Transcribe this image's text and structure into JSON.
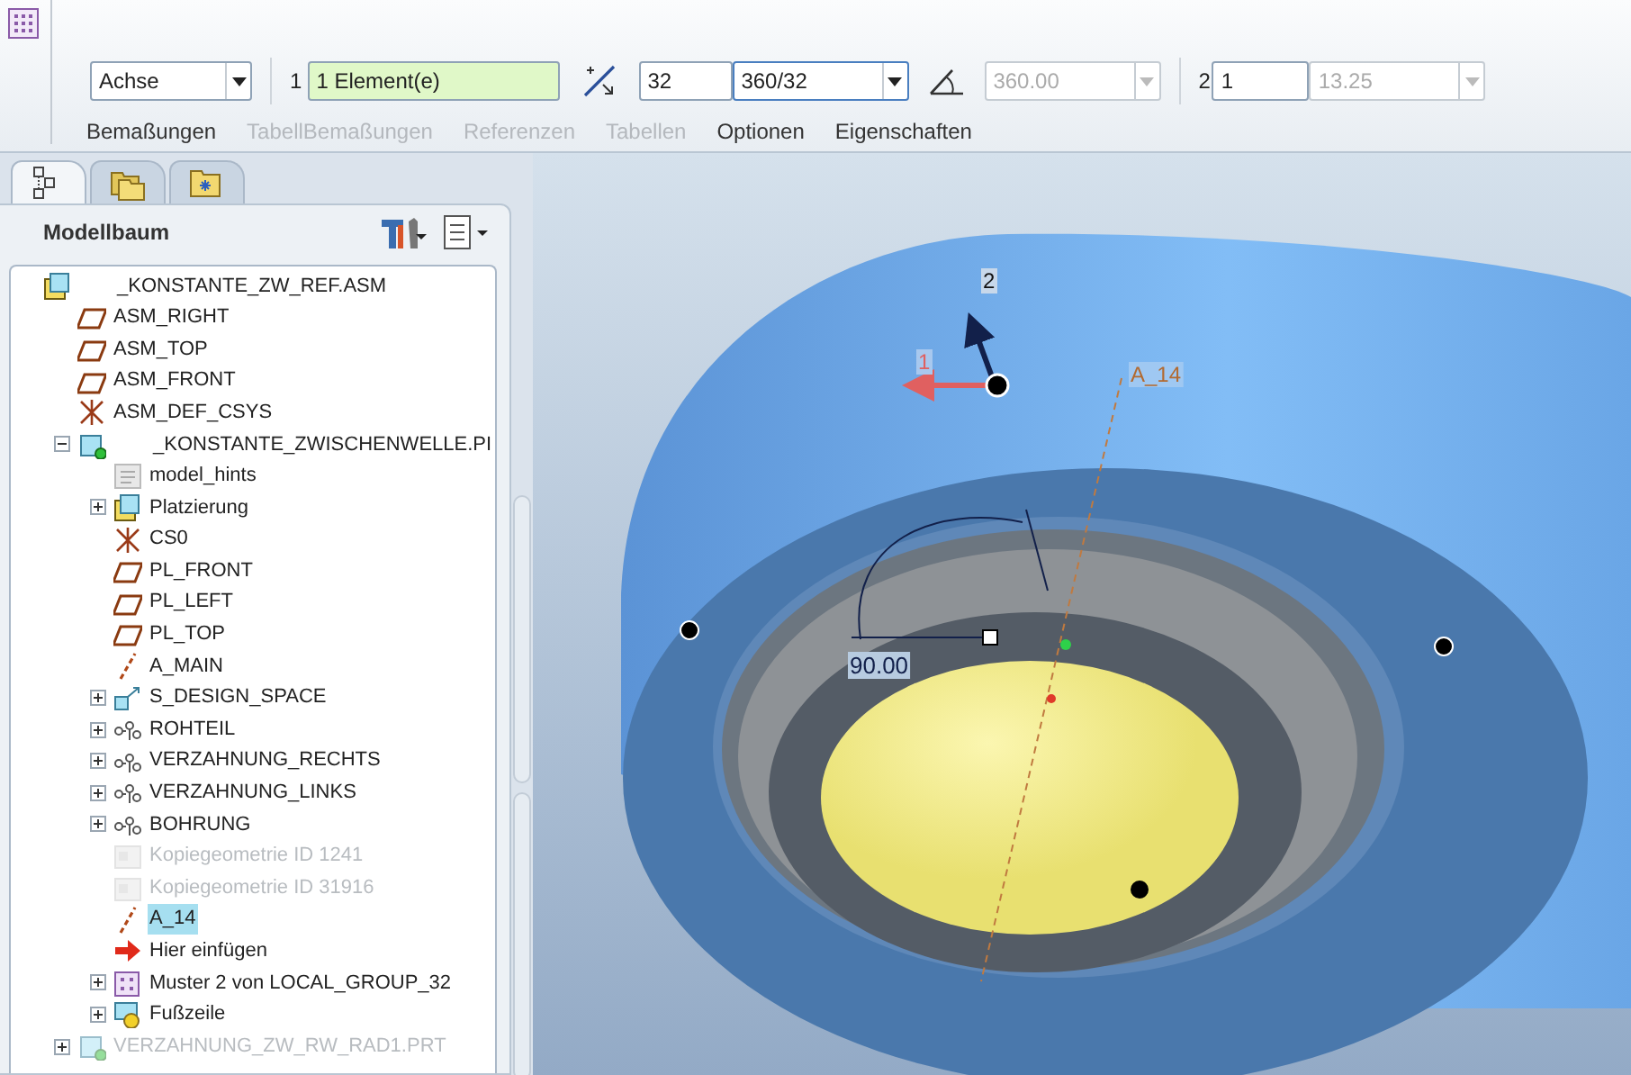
{
  "toolbar": {
    "type_select": {
      "value": "Achse"
    },
    "reference_label": "1",
    "reference_field": {
      "value": "1 Element(e)"
    },
    "count_field": {
      "value": "32"
    },
    "increment_combo": {
      "value": "360/32"
    },
    "angle_combo": {
      "value": "360.00",
      "disabled": true
    },
    "second_label": "2",
    "second_count_field": {
      "value": "1"
    },
    "second_increment_combo": {
      "value": "13.25",
      "disabled": true
    }
  },
  "ribbon_tabs": [
    {
      "label": "Bemaßungen",
      "disabled": false
    },
    {
      "label": "TabellBemaßungen",
      "disabled": true
    },
    {
      "label": "Referenzen",
      "disabled": true
    },
    {
      "label": "Tabellen",
      "disabled": true
    },
    {
      "label": "Optionen",
      "disabled": false
    },
    {
      "label": "Eigenschaften",
      "disabled": false
    }
  ],
  "panel_tabs": [
    {
      "kind": "tree",
      "selected": true
    },
    {
      "kind": "folders",
      "selected": false
    },
    {
      "kind": "favorites",
      "selected": false
    }
  ],
  "model_tree": {
    "title": "Modellbaum",
    "items": [
      {
        "label": "_KONSTANTE_ZW_REF.ASM",
        "kind": "assembly",
        "selected": false,
        "disabled": false,
        "children": [
          {
            "label": "ASM_RIGHT",
            "kind": "plane",
            "selected": false,
            "disabled": false
          },
          {
            "label": "ASM_TOP",
            "kind": "plane",
            "selected": false,
            "disabled": false
          },
          {
            "label": "ASM_FRONT",
            "kind": "plane",
            "selected": false,
            "disabled": false
          },
          {
            "label": "ASM_DEF_CSYS",
            "kind": "csys",
            "selected": false,
            "disabled": false
          },
          {
            "label": "_KONSTANTE_ZWISCHENWELLE.PI",
            "kind": "part",
            "expanded": true,
            "selected": false,
            "disabled": false,
            "children": [
              {
                "label": "model_hints",
                "kind": "notes",
                "selected": false,
                "disabled": false
              },
              {
                "label": "Platzierung",
                "kind": "placement",
                "expanded": false,
                "selected": false,
                "disabled": false
              },
              {
                "label": "CS0",
                "kind": "csys",
                "selected": false,
                "disabled": false
              },
              {
                "label": "PL_FRONT",
                "kind": "plane",
                "selected": false,
                "disabled": false
              },
              {
                "label": "PL_LEFT",
                "kind": "plane",
                "selected": false,
                "disabled": false
              },
              {
                "label": "PL_TOP",
                "kind": "plane",
                "selected": false,
                "disabled": false
              },
              {
                "label": "A_MAIN",
                "kind": "axis",
                "selected": false,
                "disabled": false
              },
              {
                "label": "S_DESIGN_SPACE",
                "kind": "component",
                "expanded": false,
                "selected": false,
                "disabled": false
              },
              {
                "label": "ROHTEIL",
                "kind": "group",
                "expanded": false,
                "selected": false,
                "disabled": false
              },
              {
                "label": "VERZAHNUNG_RECHTS",
                "kind": "group",
                "expanded": false,
                "selected": false,
                "disabled": false
              },
              {
                "label": "VERZAHNUNG_LINKS",
                "kind": "group",
                "expanded": false,
                "selected": false,
                "disabled": false
              },
              {
                "label": "BOHRUNG",
                "kind": "group",
                "expanded": false,
                "selected": false,
                "disabled": false
              },
              {
                "label": "Kopiegeometrie ID 1241",
                "kind": "copy",
                "selected": false,
                "disabled": true
              },
              {
                "label": "Kopiegeometrie ID 31916",
                "kind": "copy",
                "selected": false,
                "disabled": true
              },
              {
                "label": "A_14",
                "kind": "axis",
                "selected": true,
                "disabled": false
              },
              {
                "label": "Hier einfügen",
                "kind": "insert",
                "selected": false,
                "disabled": false
              },
              {
                "label": "Muster 2 von LOCAL_GROUP_32",
                "kind": "pattern",
                "expanded": false,
                "selected": false,
                "disabled": false
              },
              {
                "label": "Fußzeile",
                "kind": "footer",
                "expanded": false,
                "selected": false,
                "disabled": false
              }
            ]
          },
          {
            "label": "VERZAHNUNG_ZW_RW_RAD1.PRT",
            "kind": "part",
            "expanded": false,
            "selected": false,
            "disabled": true
          }
        ]
      }
    ]
  },
  "viewport": {
    "triad_labels": [
      "2",
      "1"
    ],
    "axis_label": "A_14",
    "angle_dimension": "90.00"
  }
}
